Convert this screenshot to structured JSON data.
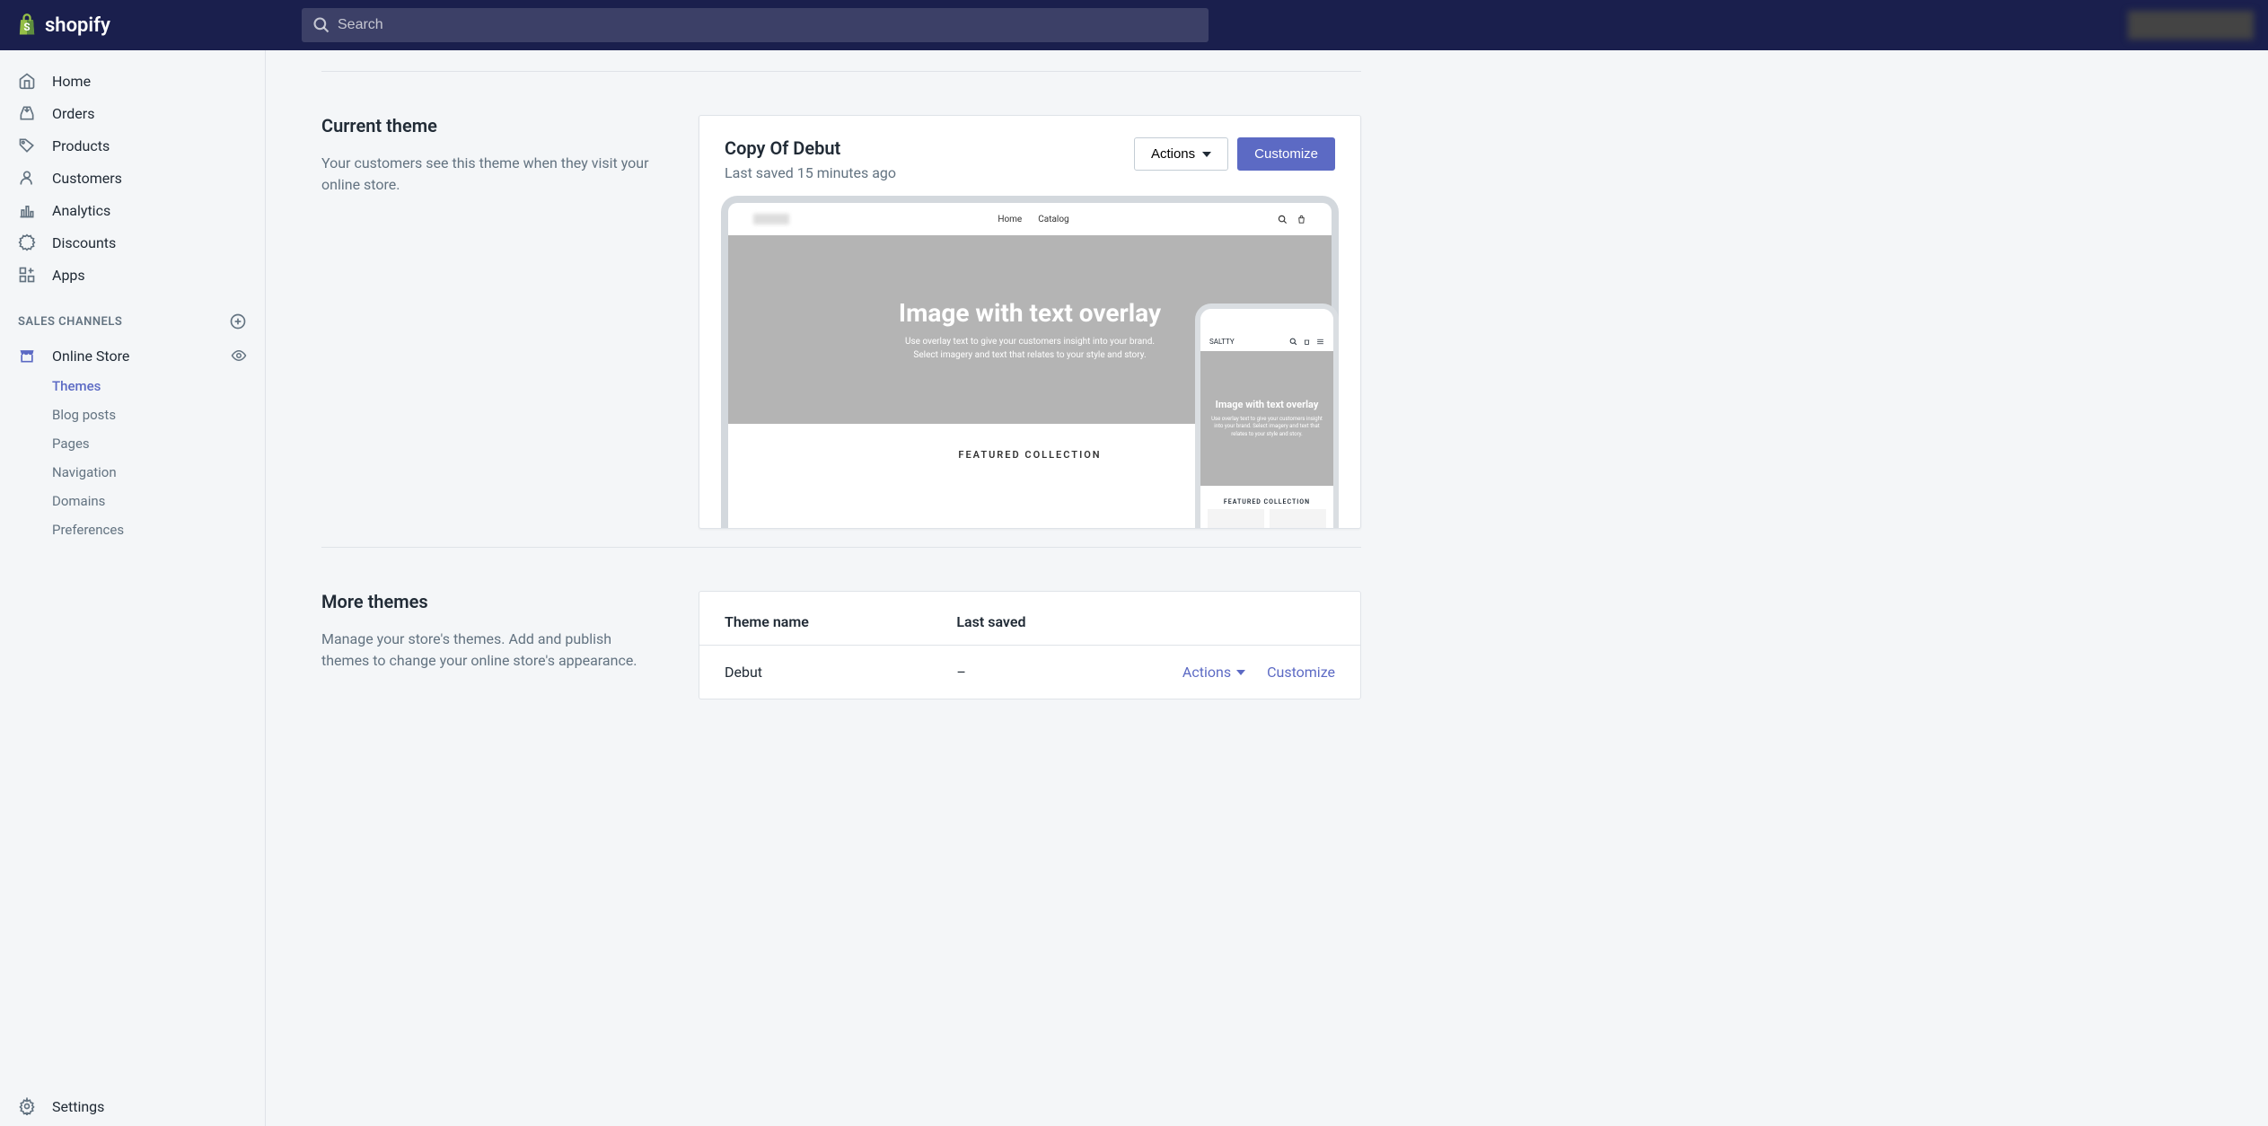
{
  "brand": "shopify",
  "search": {
    "placeholder": "Search"
  },
  "nav": {
    "items": [
      {
        "label": "Home"
      },
      {
        "label": "Orders"
      },
      {
        "label": "Products"
      },
      {
        "label": "Customers"
      },
      {
        "label": "Analytics"
      },
      {
        "label": "Discounts"
      },
      {
        "label": "Apps"
      }
    ]
  },
  "sales_channels_header": "SALES CHANNELS",
  "channel": {
    "label": "Online Store",
    "subitems": [
      {
        "label": "Themes",
        "active": true
      },
      {
        "label": "Blog posts"
      },
      {
        "label": "Pages"
      },
      {
        "label": "Navigation"
      },
      {
        "label": "Domains"
      },
      {
        "label": "Preferences"
      }
    ]
  },
  "settings_label": "Settings",
  "current_theme": {
    "heading": "Current theme",
    "description": "Your customers see this theme when they visit your online store.",
    "theme_name": "Copy Of Debut",
    "last_saved": "Last saved 15 minutes ago",
    "actions_label": "Actions",
    "customize_label": "Customize"
  },
  "preview": {
    "nav_home": "Home",
    "nav_catalog": "Catalog",
    "hero_title": "Image with text overlay",
    "hero_line1": "Use overlay text to give your customers insight into your brand.",
    "hero_line2": "Select imagery and text that relates to your style and story.",
    "featured": "FEATURED COLLECTION",
    "mobile_brand": "SALTTY",
    "mobile_hero_title": "Image with text overlay",
    "mobile_hero_text": "Use overlay text to give your customers insight into your brand. Select imagery and text that relates to your style and story.",
    "mobile_featured": "FEATURED COLLECTION"
  },
  "more_themes": {
    "heading": "More themes",
    "description": "Manage your store's themes. Add and publish themes to change your online store's appearance.",
    "col_name": "Theme name",
    "col_saved": "Last saved",
    "rows": [
      {
        "name": "Debut",
        "saved": "–",
        "actions_label": "Actions",
        "customize_label": "Customize"
      }
    ]
  }
}
